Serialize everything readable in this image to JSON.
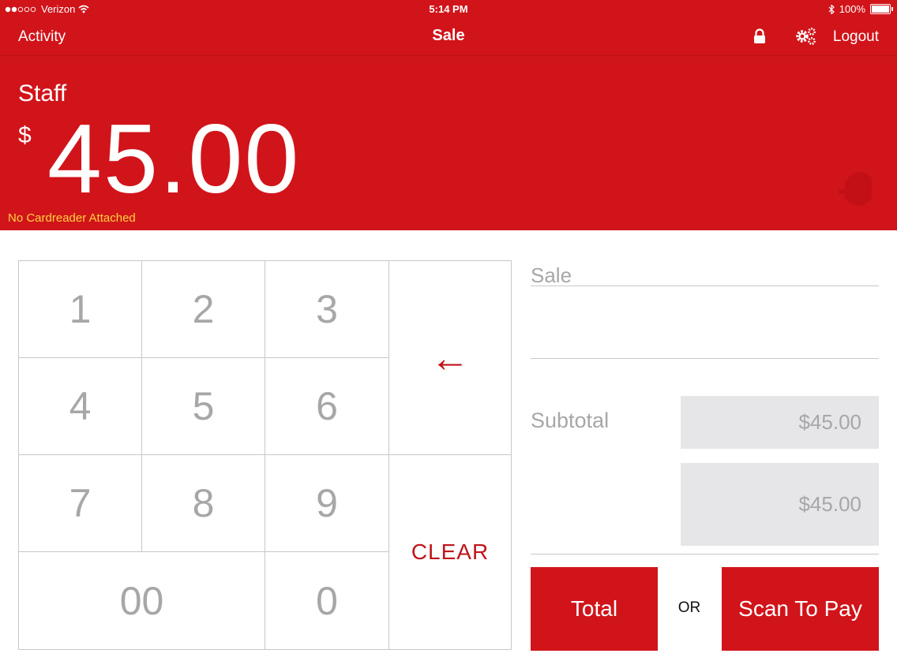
{
  "status_bar": {
    "carrier": "Verizon",
    "time": "5:14 PM",
    "battery": "100%"
  },
  "nav": {
    "left": "Activity",
    "title": "Sale",
    "right": "Logout"
  },
  "header": {
    "user": "Staff",
    "currency": "$",
    "amount": "45.00",
    "warning": "No Cardreader Attached"
  },
  "keypad": {
    "keys": [
      "1",
      "2",
      "3",
      "4",
      "5",
      "6",
      "7",
      "8",
      "9",
      "00",
      "0"
    ],
    "backspace": "←",
    "clear": "CLEAR"
  },
  "summary": {
    "sale_placeholder": "Sale",
    "subtotal_label": "Subtotal",
    "subtotal_value": "$45.00",
    "total_value": "$45.00",
    "total_button": "Total",
    "or": "OR",
    "scan_button": "Scan To Pay"
  },
  "colors": {
    "brand_red": "#d1141a",
    "warning_yellow": "#ffd23c",
    "key_text": "#a7a7a7"
  }
}
